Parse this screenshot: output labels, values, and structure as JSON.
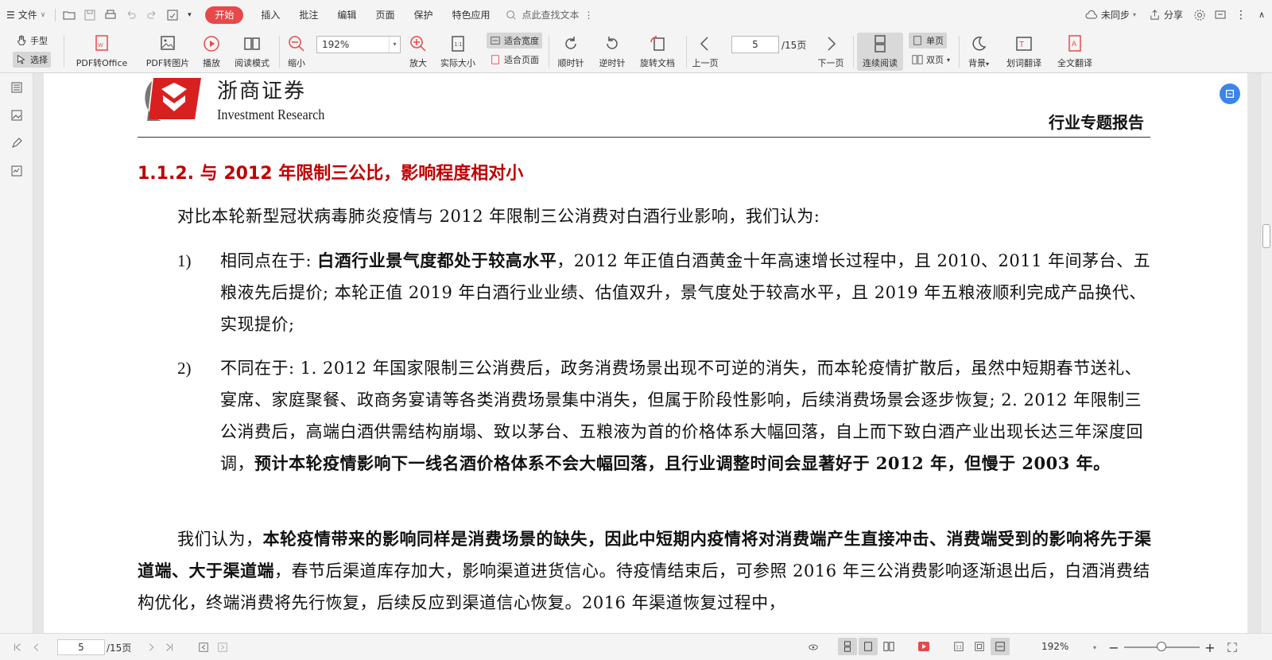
{
  "menubar": {
    "file_label": "文件",
    "tabs": [
      {
        "label": "开始",
        "active": true
      },
      {
        "label": "插入",
        "active": false
      },
      {
        "label": "批注",
        "active": false
      },
      {
        "label": "编辑",
        "active": false
      },
      {
        "label": "页面",
        "active": false
      },
      {
        "label": "保护",
        "active": false
      },
      {
        "label": "特色应用",
        "active": false
      }
    ],
    "search_label": "点此查找文本",
    "sync_label": "未同步",
    "share_label": "分享",
    "accent_color": "#e8484a"
  },
  "toolbar": {
    "hand_label": "手型",
    "select_label": "选择",
    "pdf_to_office": "PDF转Office",
    "pdf_to_image": "PDF转图片",
    "play": "播放",
    "reading_mode": "阅读模式",
    "zoom_out": "缩小",
    "zoom_value": "192%",
    "zoom_in": "放大",
    "actual_size": "实际大小",
    "fit_width": "适合宽度",
    "fit_page": "适合页面",
    "rotate_cw": "顺时针",
    "rotate_ccw": "逆时针",
    "rotate_doc": "旋转文档",
    "prev_page": "上一页",
    "page_current": "5",
    "page_total": "/15页",
    "next_page": "下一页",
    "continuous_read": "连续阅读",
    "single_page": "单页",
    "double_page": "双页",
    "background": "背景",
    "word_translate": "划词翻译",
    "full_translate": "全文翻译"
  },
  "document": {
    "logo_cn": "浙商证券",
    "logo_en": "Investment Research",
    "report_type": "行业专题报告",
    "section_title": "1.1.2. 与 2012 年限制三公比，影响程度相对小",
    "intro": "对比本轮新型冠状病毒肺炎疫情与 2012 年限制三公消费对白酒行业影响，我们认为:",
    "item1": {
      "num": "1)",
      "prefix": "相同点在于: ",
      "bold": "白酒行业景气度都处于较高水平",
      "rest": "，2012 年正值白酒黄金十年高速增长过程中，且 2010、2011 年间茅台、五粮液先后提价; 本轮正值 2019 年白酒行业业绩、估值双升，景气度处于较高水平，且 2019 年五粮液顺利完成产品换代、实现提价;"
    },
    "item2": {
      "num": "2)",
      "text": "不同在于: 1. 2012 年国家限制三公消费后，政务消费场景出现不可逆的消失，而本轮疫情扩散后，虽然中短期春节送礼、宴席、家庭聚餐、政商务宴请等各类消费场景集中消失，但属于阶段性影响，后续消费场景会逐步恢复; 2. 2012 年限制三公消费后，高端白酒供需结构崩塌、致以茅台、五粮液为首的价格体系大幅回落，自上而下致白酒产业出现长达三年深度回调，",
      "bold": "预计本轮疫情影响下一线名酒价格体系不会大幅回落，且行业调整时间会显著好于 2012 年，但慢于 2003 年。"
    },
    "last": {
      "prefix": "我们认为，",
      "bold": "本轮疫情带来的影响同样是消费场景的缺失，因此中短期内疫情将对消费端产生直接冲击、消费端受到的影响将先于渠道端、大于渠道端",
      "rest": "，春节后渠道库存加大，影响渠道进货信心。待疫情结束后，可参照 2016 年三公消费影响逐渐退出后，白酒消费结构优化，终端消费将先行恢复，后续反应到渠道信心恢复。2016 年渠道恢复过程中，"
    },
    "title_color": "#c00000"
  },
  "statusbar": {
    "page_current": "5",
    "page_total": "/15页",
    "zoom": "192%"
  }
}
